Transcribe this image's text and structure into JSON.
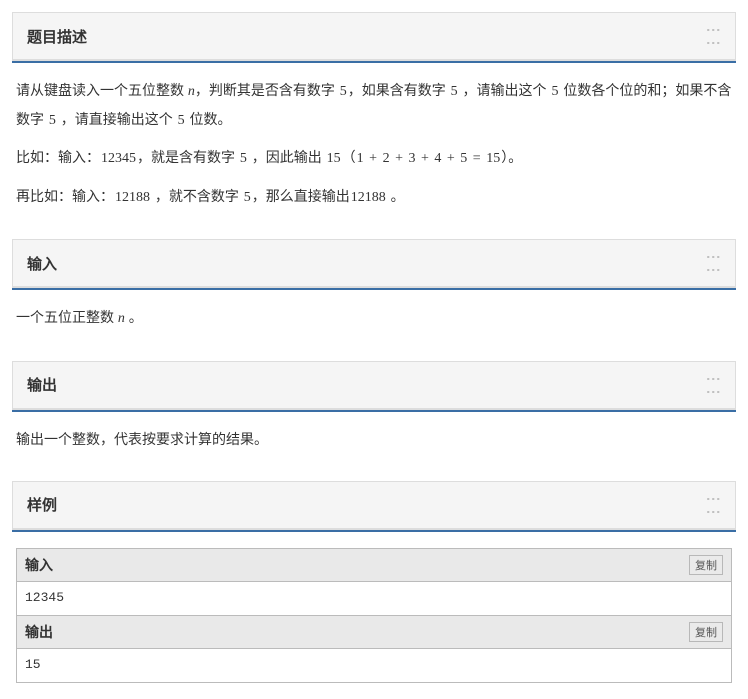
{
  "sections": {
    "description": {
      "title": "题目描述",
      "para1_a": "请从键盘读入一个五位整数 ",
      "para1_var": "n",
      "para1_b": "，判断其是否含有数字 ",
      "para1_c": "，如果含有数字 ",
      "para1_d": " ，请输出这个 ",
      "para1_e": " 位数各个位的和；如果不含数字 ",
      "para1_f": " ，请直接输出这个 ",
      "para1_g": " 位数。",
      "num5": "5",
      "para2_a": "比如：输入：",
      "para2_b": "，就是含有数字 ",
      "para2_c": " ，因此输出 ",
      "para2_d": "（",
      "para2_e": "）。",
      "n_12345": "12345",
      "n_15text": "15",
      "sum_expr_1": "1",
      "sum_expr_2": "2",
      "sum_expr_3": "3",
      "sum_expr_4": "4",
      "sum_expr_5": "5",
      "plus": " + ",
      "eq": " = ",
      "n_15": "15",
      "para3_a": "再比如：输入：",
      "para3_b": " ，就不含数字 ",
      "para3_c": "，那么直接输出",
      "para3_d": " 。",
      "n_12188": "12188",
      "n_12188b": "12188"
    },
    "input": {
      "title": "输入",
      "text_a": "一个五位正整数 ",
      "var": "n",
      "text_b": " 。"
    },
    "output": {
      "title": "输出",
      "text": "输出一个整数，代表按要求计算的结果。"
    },
    "sample": {
      "title": "样例",
      "input_label": "输入",
      "output_label": "输出",
      "copy_label": "复制",
      "input_value": "12345",
      "output_value": "15"
    }
  }
}
